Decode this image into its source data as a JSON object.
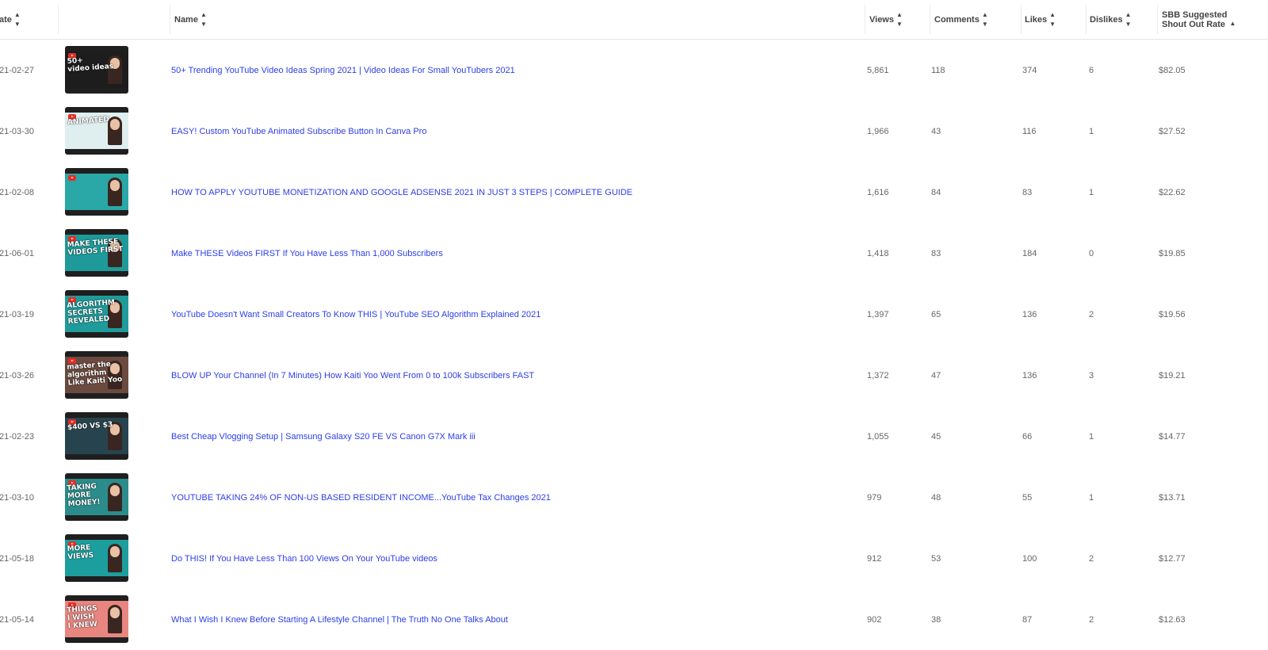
{
  "header": {
    "date": "ate",
    "name": "Name",
    "views": "Views",
    "comments": "Comments",
    "likes": "Likes",
    "dislikes": "Dislikes",
    "rate_line1": "SBB Suggested",
    "rate_line2": "Shout Out Rate"
  },
  "rows": [
    {
      "date": "21-02-27",
      "title": "50+ Trending YouTube Video Ideas Spring 2021 | Video Ideas For Small YouTubers 2021",
      "views": "5,861",
      "comments": "118",
      "likes": "374",
      "dislikes": "6",
      "rate": "$82.05",
      "thumb_text": "50+\nvideo ideas",
      "thumb_bg": "#1d1d1d"
    },
    {
      "date": "21-03-30",
      "title": "EASY! Custom YouTube Animated Subscribe Button In Canva Pro",
      "views": "1,966",
      "comments": "43",
      "likes": "116",
      "dislikes": "1",
      "rate": "$27.52",
      "thumb_text": "ANIMATED",
      "thumb_bg": "#dfeff0"
    },
    {
      "date": "21-02-08",
      "title": "HOW TO APPLY YOUTUBE MONETIZATION AND GOOGLE ADSENSE 2021 IN JUST 3 STEPS | COMPLETE GUIDE",
      "views": "1,616",
      "comments": "84",
      "likes": "83",
      "dislikes": "1",
      "rate": "$22.62",
      "thumb_text": "",
      "thumb_bg": "#2aa8a8"
    },
    {
      "date": "21-06-01",
      "title": "Make THESE Videos FIRST If You Have Less Than 1,000 Subscribers",
      "views": "1,418",
      "comments": "83",
      "likes": "184",
      "dislikes": "0",
      "rate": "$19.85",
      "thumb_text": "MAKE THESE\nVIDEOS FIRST",
      "thumb_bg": "#1e9a9a"
    },
    {
      "date": "21-03-19",
      "title": "YouTube Doesn't Want Small Creators To Know THIS | YouTube SEO Algorithm Explained 2021",
      "views": "1,397",
      "comments": "65",
      "likes": "136",
      "dislikes": "2",
      "rate": "$19.56",
      "thumb_text": "ALGORITHM\nSECRETS\nREVEALED",
      "thumb_bg": "#1f9b9b"
    },
    {
      "date": "21-03-26",
      "title": "BLOW UP Your Channel (In 7 Minutes) How Kaiti Yoo Went From 0 to 100k Subscribers FAST",
      "views": "1,372",
      "comments": "47",
      "likes": "136",
      "dislikes": "3",
      "rate": "$19.21",
      "thumb_text": "master the algorithm\nLike Kaiti Yoo",
      "thumb_bg": "#6b4a3f"
    },
    {
      "date": "21-02-23",
      "title": "Best Cheap Vlogging Setup | Samsung Galaxy S20 FE VS Canon G7X Mark iii",
      "views": "1,055",
      "comments": "45",
      "likes": "66",
      "dislikes": "1",
      "rate": "$14.77",
      "thumb_text": "$400   VS   $3",
      "thumb_bg": "#27444e"
    },
    {
      "date": "21-03-10",
      "title": "YOUTUBE TAKING 24% OF NON-US BASED RESIDENT INCOME...YouTube Tax Changes 2021",
      "views": "979",
      "comments": "48",
      "likes": "55",
      "dislikes": "1",
      "rate": "$13.71",
      "thumb_text": "TAKING\nMORE\nMONEY!",
      "thumb_bg": "#2b8c8c"
    },
    {
      "date": "21-05-18",
      "title": "Do THIS! If You Have Less Than 100 Views On Your YouTube videos",
      "views": "912",
      "comments": "53",
      "likes": "100",
      "dislikes": "2",
      "rate": "$12.77",
      "thumb_text": "MORE\nVIEWS",
      "thumb_bg": "#1c9e9e"
    },
    {
      "date": "21-05-14",
      "title": "What I Wish I Knew Before Starting A Lifestyle Channel | The Truth No One Talks About",
      "views": "902",
      "comments": "38",
      "likes": "87",
      "dislikes": "2",
      "rate": "$12.63",
      "thumb_text": "THINGS\nI WISH\nI KNEW",
      "thumb_bg": "#e8857f"
    }
  ]
}
